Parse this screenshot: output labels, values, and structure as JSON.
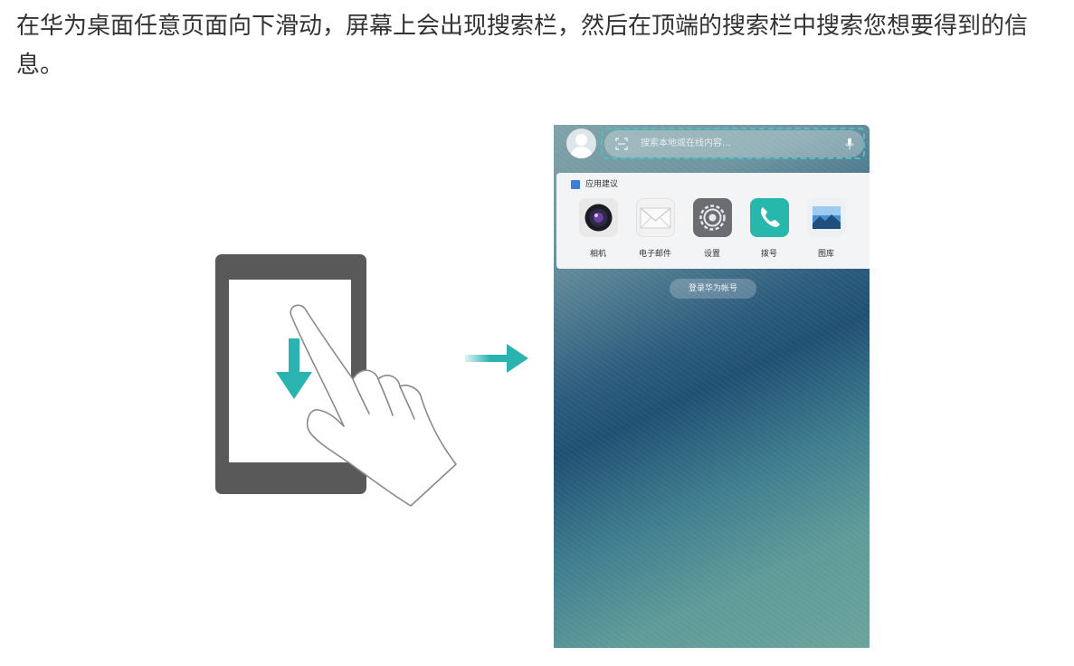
{
  "intro_text": "在华为桌面任意页面向下滑动，屏幕上会出现搜索栏，然后在顶端的搜索栏中搜索您想要得到的信息。",
  "phone": {
    "search_placeholder": "搜索本地或在线内容…",
    "suggest_header": "应用建议",
    "apps": [
      {
        "label": "相机",
        "icon": "camera-icon"
      },
      {
        "label": "电子邮件",
        "icon": "email-icon"
      },
      {
        "label": "设置",
        "icon": "settings-icon"
      },
      {
        "label": "拨号",
        "icon": "phone-icon"
      },
      {
        "label": "图库",
        "icon": "gallery-icon"
      }
    ],
    "login_label": "登录华为帐号"
  },
  "colors": {
    "accent_teal": "#2bb3b1",
    "tablet_frame": "#595959",
    "text": "#333333"
  }
}
